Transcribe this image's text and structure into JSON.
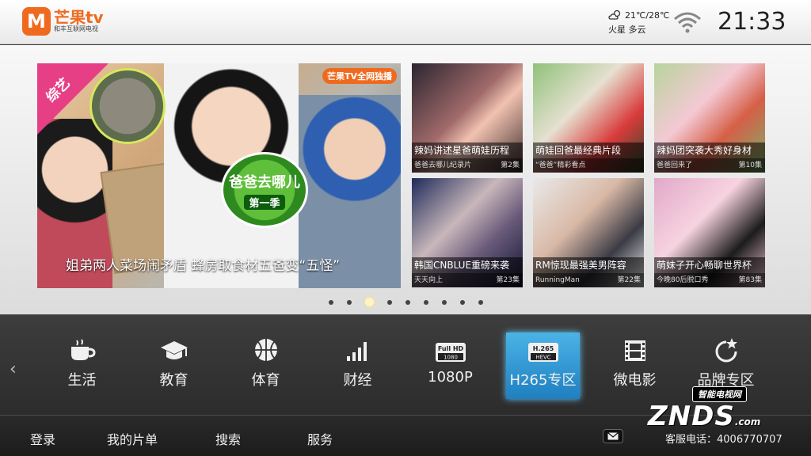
{
  "header": {
    "logo_mark": "M",
    "logo_name": "芒果tv",
    "logo_sub": "和丰互联网电视",
    "weather_temp": "21℃/28℃",
    "weather_day": "火星 多云",
    "clock": "21:33"
  },
  "hero": {
    "badge": "综艺",
    "show_logo": "爸爸去哪儿",
    "show_season": "第一季",
    "channel_tag": "芒果TV全网独播",
    "caption": "姐弟两人菜场闹矛盾  蜂房取食材五爸变“五怪”"
  },
  "thumbs": [
    {
      "title": "辣妈讲述星爸萌娃历程",
      "subtitle": "爸爸去哪儿纪录片",
      "episode": "第2集"
    },
    {
      "title": "萌娃回爸最经典片段",
      "subtitle": "“爸爸”精彩看点",
      "episode": ""
    },
    {
      "title": "辣妈团突袭大秀好身材",
      "subtitle": "爸爸回来了",
      "episode": "第10集"
    },
    {
      "title": "韩国CNBLUE重磅来袭",
      "subtitle": "天天向上",
      "episode": "第23集"
    },
    {
      "title": "RM惊现最强美男阵容",
      "subtitle": "RunningMan",
      "episode": "第22集"
    },
    {
      "title": "萌妹子开心畅聊世界杯",
      "subtitle": "今晚80后脱口秀",
      "episode": "第83集"
    }
  ],
  "carousel": {
    "count": 9,
    "active_index": 2
  },
  "categories": [
    {
      "label": "生活",
      "icon": "coffee-cup-icon"
    },
    {
      "label": "教育",
      "icon": "graduation-cap-icon"
    },
    {
      "label": "体育",
      "icon": "basketball-icon"
    },
    {
      "label": "财经",
      "icon": "bar-chart-icon"
    },
    {
      "label": "1080P",
      "icon": "full-hd-1080-icon",
      "icon_text_top": "Full HD",
      "icon_text_bottom": "1080"
    },
    {
      "label": "H265专区",
      "icon": "h265-hevc-icon",
      "icon_text_top": "H.265",
      "icon_text_bottom": "HEVC",
      "selected": true
    },
    {
      "label": "微电影",
      "icon": "film-strip-icon"
    },
    {
      "label": "品牌专区",
      "icon": "star-badge-icon"
    }
  ],
  "bottom_nav": {
    "login": "登录",
    "my_list": "我的片单",
    "search": "搜索",
    "service": "服务",
    "hotline": "客服电话：4006770707"
  },
  "watermark": {
    "top": "智能电视网",
    "main": "ZNDS",
    "suffix": ".com"
  },
  "colors": {
    "brand": "#ef6a1f",
    "selected_tile": "#2a93d5",
    "badge": "#e63f86"
  }
}
